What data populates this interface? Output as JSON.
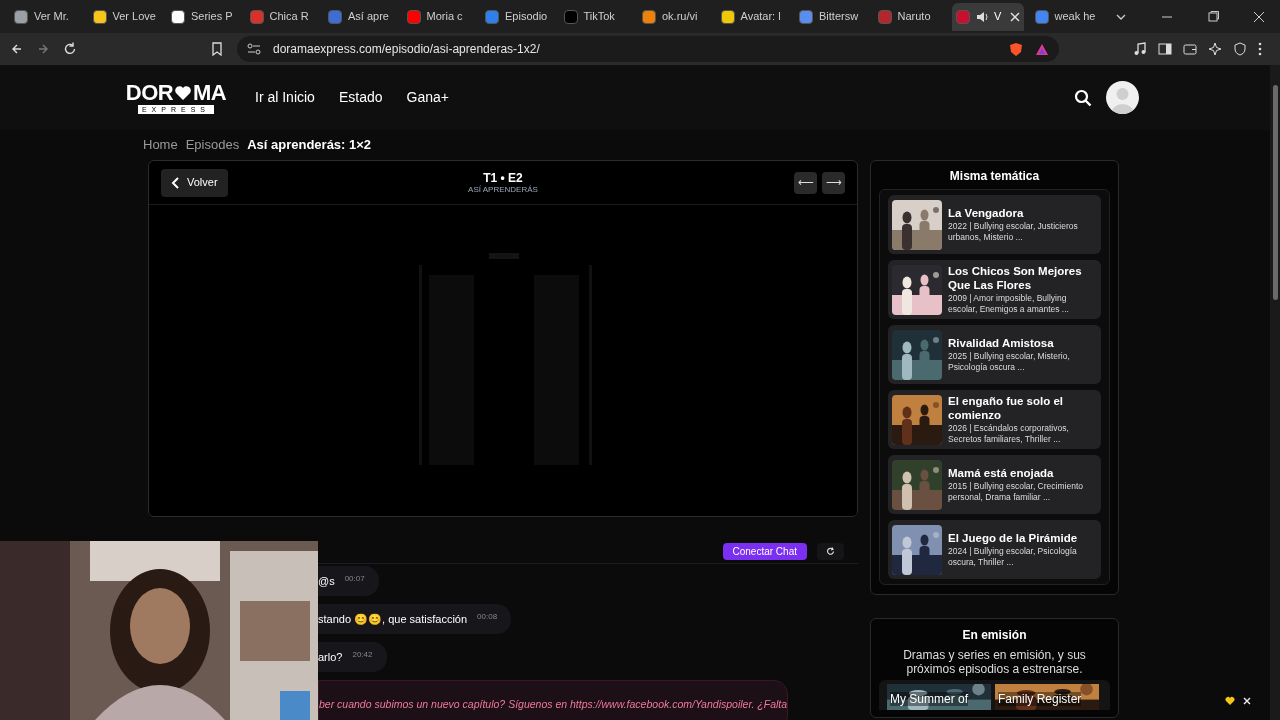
{
  "browser": {
    "tabs": [
      {
        "title": "Ver Mr.",
        "color": "#9aa0a6",
        "selected": false
      },
      {
        "title": "Ver Love",
        "color": "#f5c518",
        "selected": false
      },
      {
        "title": "Series P",
        "color": "#ffffff",
        "selected": false
      },
      {
        "title": "Chica R",
        "color": "#d9302c",
        "selected": false
      },
      {
        "title": "Así apre",
        "color": "#3b6fd6",
        "selected": false
      },
      {
        "title": "Moria c",
        "color": "#ff0000",
        "selected": false
      },
      {
        "title": "Episodio",
        "color": "#2f80ed",
        "selected": false
      },
      {
        "title": "TikTok",
        "color": "#000000",
        "selected": false
      },
      {
        "title": "ok.ru/vi",
        "color": "#ee8208",
        "selected": false
      },
      {
        "title": "Avatar: l",
        "color": "#f0c808",
        "selected": false
      },
      {
        "title": "Bittersw",
        "color": "#5b8def",
        "selected": false
      },
      {
        "title": "Naruto",
        "color": "#b3262c",
        "selected": false
      },
      {
        "title": "V",
        "color": "#c8102e",
        "selected": true
      },
      {
        "title": "weak he",
        "color": "#4285f4",
        "selected": false
      }
    ],
    "url": "doramaexpress.com/episodio/asi-aprenderas-1x2/"
  },
  "site": {
    "logo": {
      "part_1": "DOR",
      "part_2": "MA",
      "tagline": "EXPRESS"
    },
    "nav": [
      "Ir al Inicio",
      "Estado",
      "Gana+"
    ]
  },
  "breadcrumb": [
    "Home",
    "Episodes",
    "Así aprenderás: 1×2"
  ],
  "player": {
    "back": "Volver",
    "episode": "T1 • E2",
    "title": "ASÍ APRENDERÁS",
    "prev": "⟵",
    "next": "⟶"
  },
  "chat": {
    "connect": "Conectar Chat",
    "messages": [
      {
        "kind": "user",
        "text": "@s",
        "time": "00:07"
      },
      {
        "kind": "user",
        "text": "stando 😊😊, que satisfacción",
        "time": "00:08"
      },
      {
        "kind": "user",
        "text": "arlo?",
        "time": "20:42"
      },
      {
        "kind": "notice",
        "text": "ber cuando subimos un nuevo capítulo? Síguenos en https://www.facebook.com/Yandispoiler. ¿Falta"
      }
    ]
  },
  "sidebar": {
    "title": "Misma temática",
    "items": [
      {
        "title": "La Vengadora",
        "meta": "2022 | Bullying escolar, Justicieros urbanos, Misterio ..."
      },
      {
        "title": "Los Chicos Son Mejores Que Las Flores",
        "meta": "2009 | Amor imposible, Bullying escolar, Enemigos a amantes ..."
      },
      {
        "title": "Rivalidad Amistosa",
        "meta": "2025 | Bullying escolar, Misterio, Psicología oscura ..."
      },
      {
        "title": "El engaño fue solo el comienzo",
        "meta": "2026 | Escándalos corporativos, Secretos familiares, Thriller ..."
      },
      {
        "title": "Mamá está enojada",
        "meta": "2015 | Bullying escolar, Crecimiento personal, Drama familiar ..."
      },
      {
        "title": "El Juego de la Pirámide",
        "meta": "2024 | Bullying escolar, Psicología oscura, Thriller ..."
      }
    ]
  },
  "airing": {
    "title": "En emisión",
    "description": "Dramas y series en emisión, y sus próximos episodios a estrenarse.",
    "cards": [
      {
        "title": "My Summer of"
      },
      {
        "title": "Family Register"
      }
    ]
  }
}
